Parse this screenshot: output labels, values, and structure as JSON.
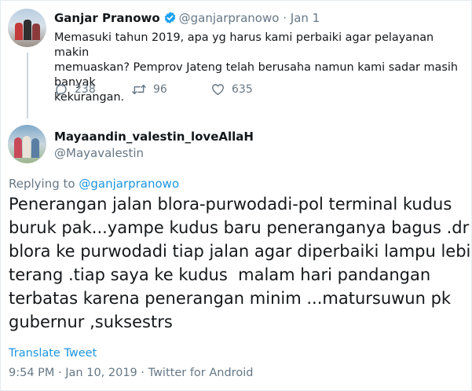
{
  "parent_tweet": {
    "display_name": "Ganjar Pranowo",
    "handle": "@ganjarpranowo",
    "separator": "·",
    "date": "Jan 1",
    "text_lines": [
      "Memasuki tahun 2019, apa yg harus kami perbaiki agar pelayanan makin",
      "memuaskan? Pemprov Jateng telah berusaha namun kami sadar masih banyak",
      "kekurangan."
    ],
    "reply_count": "238",
    "retweet_count": "96",
    "like_count": "635",
    "icons": [
      "verified-badge-icon",
      "reply-icon",
      "retweet-icon",
      "like-icon"
    ],
    "accent_color": "#1da1f2"
  },
  "reply_tweet": {
    "display_name": "Mayaandin_valestin_loveAllaH",
    "handle": "@Mayavalestin",
    "replying_prefix": "Replying to",
    "replying_handle": "@ganjarpranowo",
    "text_lines": [
      "Penerangan jalan blora-purwodadi-pol terminal kudus",
      "buruk pak...yampe kudus baru peneranganya bagus .dr",
      "blora ke purwodadi tiap jalan agar diperbaiki lampu lebih",
      "terang .tiap saya ke kudus  malam hari pandangan",
      "terbatas karena penerangan minim ...matursuwun pk",
      "gubernur ,suksestrs"
    ],
    "translate_label": "Translate Tweet",
    "meta": "9:54 PM · Jan 10, 2019 · Twitter for Android",
    "link_color": "#1b95e0"
  }
}
